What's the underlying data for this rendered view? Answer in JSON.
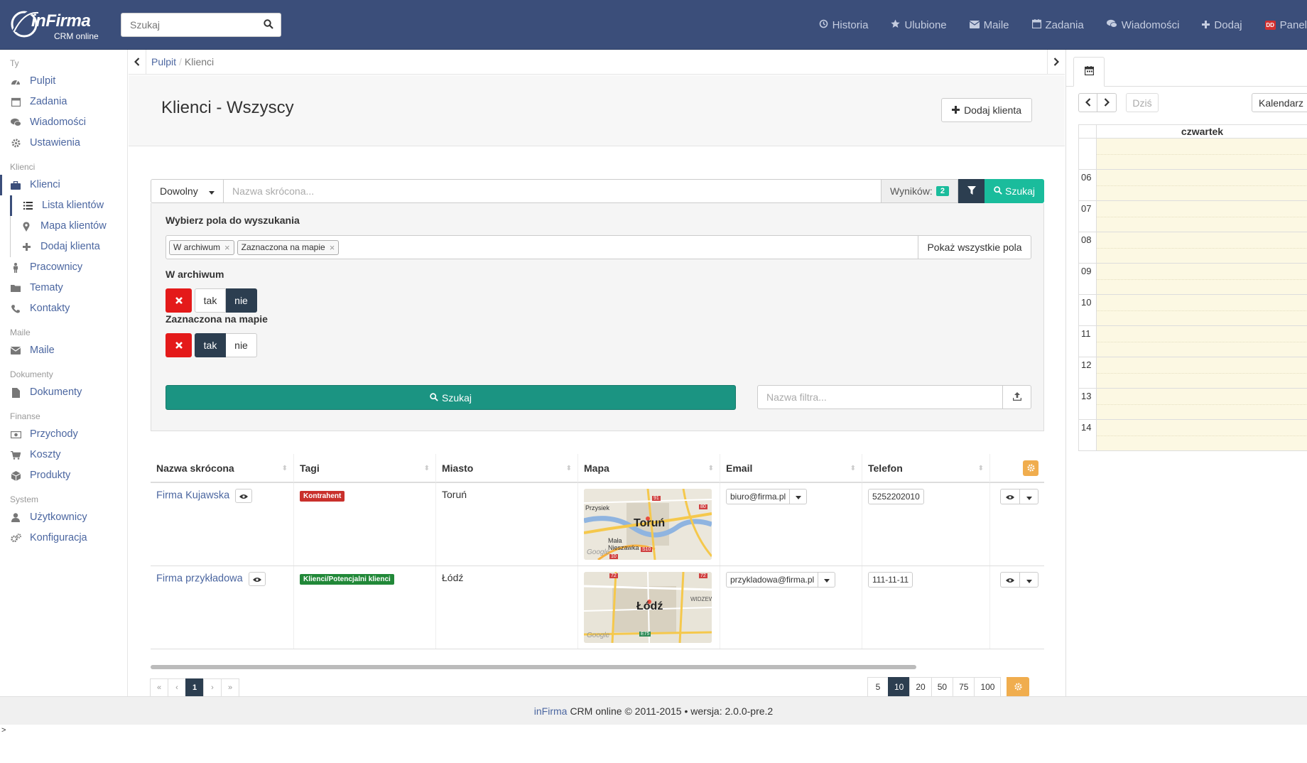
{
  "header": {
    "logo_brand": "inFirma",
    "logo_sub": "CRM online",
    "search_placeholder": "Szukaj",
    "nav": [
      {
        "label": "Historia",
        "icon": "history-icon"
      },
      {
        "label": "Ulubione",
        "icon": "star-icon"
      },
      {
        "label": "Maile",
        "icon": "envelope-icon"
      },
      {
        "label": "Zadania",
        "icon": "calendar-icon"
      },
      {
        "label": "Wiadomości",
        "icon": "comments-icon"
      },
      {
        "label": "Dodaj",
        "icon": "plus-icon"
      },
      {
        "label": "Panel",
        "icon": "avatar-icon",
        "avatar_text": "DD"
      }
    ]
  },
  "sidebar": {
    "sections": [
      {
        "title": "Ty",
        "items": [
          {
            "label": "Pulpit",
            "icon": "dashboard-icon"
          },
          {
            "label": "Zadania",
            "icon": "calendar-icon"
          },
          {
            "label": "Wiadomości",
            "icon": "comments-icon"
          },
          {
            "label": "Ustawienia",
            "icon": "gear-icon"
          }
        ]
      },
      {
        "title": "Klienci",
        "items": [
          {
            "label": "Klienci",
            "icon": "briefcase-icon"
          },
          {
            "label": "Lista klientów",
            "icon": "list-icon"
          },
          {
            "label": "Mapa klientów",
            "icon": "map-marker-icon"
          },
          {
            "label": "Dodaj klienta",
            "icon": "plus-icon"
          },
          {
            "label": "Pracownicy",
            "icon": "male-icon"
          },
          {
            "label": "Tematy",
            "icon": "folder-icon"
          },
          {
            "label": "Kontakty",
            "icon": "phone-icon"
          }
        ]
      },
      {
        "title": "Maile",
        "items": [
          {
            "label": "Maile",
            "icon": "envelope-icon"
          }
        ]
      },
      {
        "title": "Dokumenty",
        "items": [
          {
            "label": "Dokumenty",
            "icon": "file-icon"
          }
        ]
      },
      {
        "title": "Finanse",
        "items": [
          {
            "label": "Przychody",
            "icon": "money-icon"
          },
          {
            "label": "Koszty",
            "icon": "cart-icon"
          },
          {
            "label": "Produkty",
            "icon": "cube-icon"
          }
        ]
      },
      {
        "title": "System",
        "items": [
          {
            "label": "Użytkownicy",
            "icon": "user-icon"
          },
          {
            "label": "Konfiguracja",
            "icon": "cogs-icon"
          }
        ]
      }
    ]
  },
  "breadcrumb": {
    "home": "Pulpit",
    "sep": "/",
    "current": "Klienci"
  },
  "page": {
    "title": "Klienci - Wszyscy",
    "add_button": "Dodaj klienta"
  },
  "search": {
    "type_select": "Dowolny",
    "name_placeholder": "Nazwa skrócona...",
    "results_label": "Wyników:",
    "results_count": "2",
    "search_button": "Szukaj"
  },
  "filters": {
    "fields_label": "Wybierz pola do wyszukania",
    "selected_fields": [
      "W archiwum",
      "Zaznaczona na mapie"
    ],
    "show_all_button": "Pokaż wszystkie pola",
    "archive_label": "W archiwum",
    "archive_yes": "tak",
    "archive_no": "nie",
    "archive_value": "nie",
    "map_label": "Zaznaczona na mapie",
    "map_yes": "tak",
    "map_no": "nie",
    "map_value": "tak",
    "big_search_button": "Szukaj",
    "filter_name_placeholder": "Nazwa filtra..."
  },
  "table": {
    "columns": [
      "Nazwa skrócona",
      "Tagi",
      "Miasto",
      "Mapa",
      "Email",
      "Telefon"
    ],
    "rows": [
      {
        "name": "Firma Kujawska",
        "tag": "Kontrahent",
        "tag_color": "#c9302c",
        "city": "Toruń",
        "map_label": "Toruń",
        "map_places": [
          "Przysiek",
          "Mała Nieszawka"
        ],
        "map_roads": [
          "91",
          "80",
          "S10",
          "10"
        ],
        "map_watermark": "Google",
        "email": "biuro@firma.pl",
        "phone": "5252202010"
      },
      {
        "name": "Firma przykładowa",
        "tag": "Klienci/Potencjalni klienci",
        "tag_color": "#218838",
        "city": "Łódź",
        "map_label": "Łódź",
        "map_places": [
          "WIDZEW"
        ],
        "map_roads": [
          "72",
          "72",
          "E75"
        ],
        "map_watermark": "Google",
        "email": "przykladowa@firma.pl",
        "phone": "111-11-11"
      }
    ]
  },
  "pagination": {
    "pages": [
      "«",
      "‹",
      "1",
      "›",
      "»"
    ],
    "current_page": "1",
    "per_page": [
      "5",
      "10",
      "20",
      "50",
      "75",
      "100"
    ],
    "current_per_page": "10"
  },
  "footer": {
    "brand": "inFirma",
    "text": "CRM online © 2011-2015 • wersja: 2.0.0-pre.2"
  },
  "prompt": ">",
  "calendar": {
    "today_button": "Dziś",
    "view_button": "Kalendarz",
    "day_header": "czwartek",
    "hours": [
      "06",
      "07",
      "08",
      "09",
      "10",
      "11",
      "12",
      "13",
      "14"
    ],
    "highlight_color": "#fcf8e3"
  },
  "colors": {
    "navbar": "#3b4e7a",
    "accent": "#1abc9c",
    "dark_button": "#2c3e50",
    "danger": "#e41a1a",
    "warning": "#f0ad4e"
  }
}
